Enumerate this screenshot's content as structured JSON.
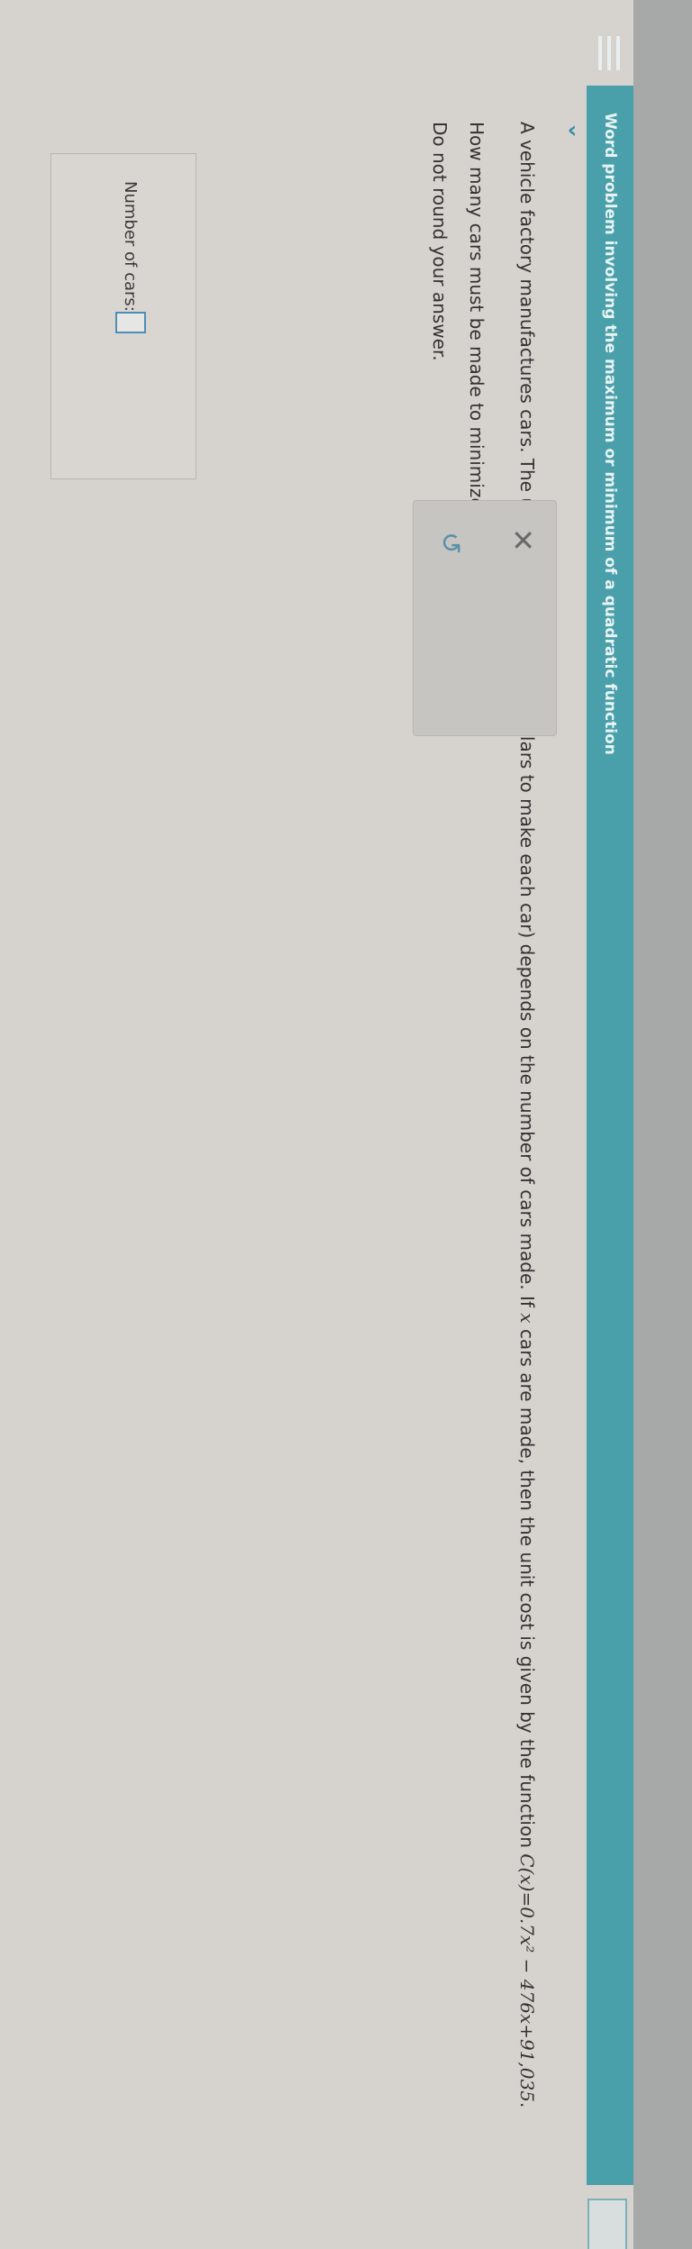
{
  "header": {
    "topic_title": "Word problem involving the maximum or minimum of a quadratic function"
  },
  "problem": {
    "line1": "A vehicle factory manufactures cars. The unit cost",
    "var_C": "C",
    "line1b": "(the cost in dollars to make each car) depends on the number of cars made. If",
    "var_x": "x",
    "line1c": "cars are made, then the",
    "line2a": "unit cost is given by the function",
    "function": "C(x)=0.7x² − 476x+91,035",
    "line2b": ". How many cars must be made to minimize the unit cost?",
    "note": "Do not round your answer."
  },
  "answer": {
    "label": "Number of cars:",
    "value": ""
  },
  "actions": {
    "clear_glyph": "✕",
    "undo_glyph": "↺"
  },
  "icons": {
    "menu": "hamburger-icon",
    "collapse": "chevron-down-icon",
    "clear": "close-icon",
    "undo": "undo-icon"
  },
  "colors": {
    "accent": "#4aa0aa",
    "input_border": "#4d8fb3"
  }
}
